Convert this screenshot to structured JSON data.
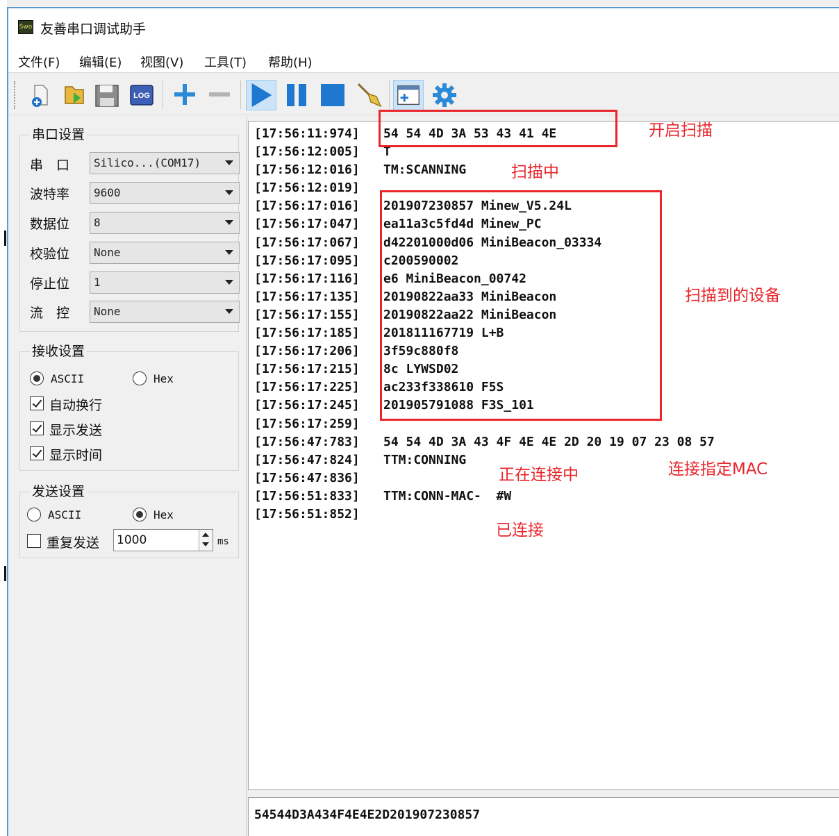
{
  "window": {
    "title": "友善串口调试助手",
    "app_icon_text": "Swo"
  },
  "menu": [
    "文件(F)",
    "编辑(E)",
    "视图(V)",
    "工具(T)",
    "帮助(H)"
  ],
  "toolbar": {
    "buttons": [
      "new-file-icon",
      "open-folder-icon",
      "save-icon",
      "log-icon",
      "add-icon",
      "remove-icon",
      "play-icon",
      "pause-icon",
      "stop-icon",
      "clear-broom-icon",
      "add-panel-icon",
      "settings-gear-icon"
    ],
    "log_label": "LOG"
  },
  "serial_settings": {
    "title": "串口设置",
    "fields": [
      {
        "label": "串　口",
        "value": "Silico...(COM17)"
      },
      {
        "label": "波特率",
        "value": "9600"
      },
      {
        "label": "数据位",
        "value": "8"
      },
      {
        "label": "校验位",
        "value": "None"
      },
      {
        "label": "停止位",
        "value": "1"
      },
      {
        "label": "流　控",
        "value": "None"
      }
    ]
  },
  "receive_settings": {
    "title": "接收设置",
    "ascii": "ASCII",
    "hex": "Hex",
    "selected": "ASCII",
    "auto_wrap": "自动换行",
    "show_send": "显示发送",
    "show_time": "显示时间"
  },
  "send_settings": {
    "title": "发送设置",
    "ascii": "ASCII",
    "hex": "Hex",
    "selected": "Hex",
    "repeat": "重复发送",
    "interval": "1000",
    "unit": "ms"
  },
  "log": [
    {
      "ts": "[17:56:11:974]",
      "msg": "54 54 4D 3A 53 43 41 4E"
    },
    {
      "ts": "[17:56:12:005]",
      "msg": "T"
    },
    {
      "ts": "[17:56:12:016]",
      "msg": "TM:SCANNING"
    },
    {
      "ts": "[17:56:12:019]",
      "msg": ""
    },
    {
      "ts": "[17:56:17:016]",
      "msg": "201907230857 Minew_V5.24L"
    },
    {
      "ts": "[17:56:17:047]",
      "msg": "ea11a3c5fd4d Minew_PC"
    },
    {
      "ts": "[17:56:17:067]",
      "msg": "d42201000d06 MiniBeacon_03334"
    },
    {
      "ts": "[17:56:17:095]",
      "msg": "c200590002"
    },
    {
      "ts": "[17:56:17:116]",
      "msg": "e6 MiniBeacon_00742"
    },
    {
      "ts": "[17:56:17:135]",
      "msg": "20190822aa33 MiniBeacon"
    },
    {
      "ts": "[17:56:17:155]",
      "msg": "20190822aa22 MiniBeacon"
    },
    {
      "ts": "[17:56:17:185]",
      "msg": "201811167719 L+B"
    },
    {
      "ts": "[17:56:17:206]",
      "msg": "3f59c880f8"
    },
    {
      "ts": "[17:56:17:215]",
      "msg": "8c LYWSD02"
    },
    {
      "ts": "[17:56:17:225]",
      "msg": "ac233f338610 F5S"
    },
    {
      "ts": "[17:56:17:245]",
      "msg": "201905791088 F3S_101"
    },
    {
      "ts": "[17:56:17:259]",
      "msg": ""
    },
    {
      "ts": "[17:56:47:783]",
      "msg": "54 54 4D 3A 43 4F 4E 4E 2D 20 19 07 23 08 57"
    },
    {
      "ts": "[17:56:47:824]",
      "msg": "TTM:CONNING"
    },
    {
      "ts": "[17:56:47:836]",
      "msg": ""
    },
    {
      "ts": "[17:56:51:833]",
      "msg": "TTM:CONN-MAC-  #W"
    },
    {
      "ts": "[17:56:51:852]",
      "msg": ""
    }
  ],
  "send_text": "54544D3A434F4E4E2D201907230857",
  "annotations": {
    "start_scan": "开启扫描",
    "scanning": "扫描中",
    "found_devices": "扫描到的设备",
    "connecting": "正在连接中",
    "connect_mac": "连接指定MAC",
    "connected": "已连接"
  },
  "colors": {
    "annotation": "#e8262b",
    "accent_blue": "#2a8ad8",
    "window_border": "#5b9bd5"
  }
}
